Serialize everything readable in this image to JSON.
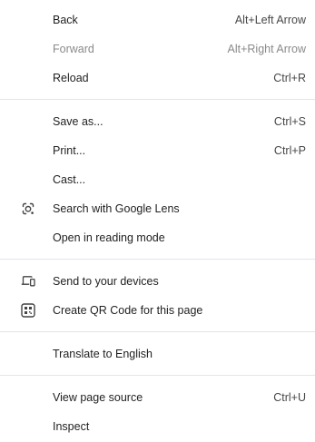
{
  "menu": {
    "nav": {
      "back": {
        "label": "Back",
        "shortcut": "Alt+Left Arrow"
      },
      "forward": {
        "label": "Forward",
        "shortcut": "Alt+Right Arrow",
        "disabled": true
      },
      "reload": {
        "label": "Reload",
        "shortcut": "Ctrl+R"
      }
    },
    "page": {
      "save_as": {
        "label": "Save as...",
        "shortcut": "Ctrl+S"
      },
      "print": {
        "label": "Print...",
        "shortcut": "Ctrl+P"
      },
      "cast": {
        "label": "Cast..."
      },
      "lens": {
        "label": "Search with Google Lens",
        "icon": "google-lens-icon"
      },
      "reading_mode": {
        "label": "Open in reading mode"
      }
    },
    "share": {
      "send_devices": {
        "label": "Send to your devices",
        "icon": "devices-icon"
      },
      "qr_code": {
        "label": "Create QR Code for this page",
        "icon": "qr-code-icon"
      }
    },
    "translate": {
      "label": "Translate to English"
    },
    "dev": {
      "view_source": {
        "label": "View page source",
        "shortcut": "Ctrl+U"
      },
      "inspect": {
        "label": "Inspect"
      }
    }
  },
  "colors": {
    "text": "#1f1f1f",
    "disabled_text": "#8a8a8a",
    "separator": "#dfe6ef",
    "background": "#ffffff"
  }
}
